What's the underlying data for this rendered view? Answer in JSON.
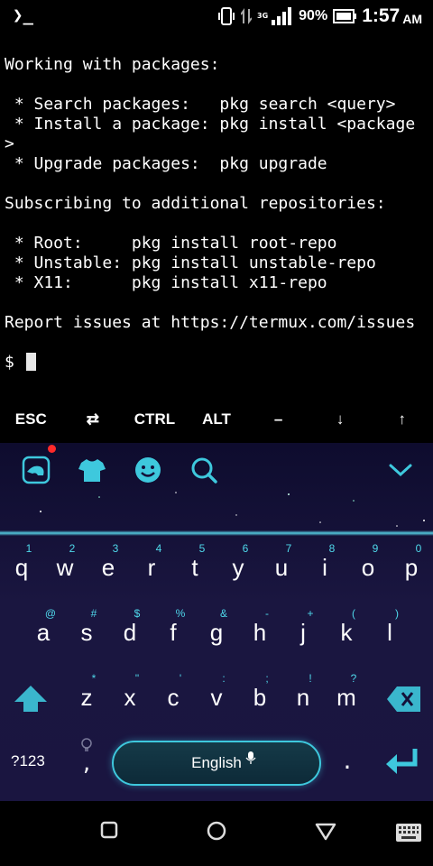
{
  "status_bar": {
    "app_icon_text": "❯_",
    "network_type": "3G",
    "battery_percent": "90%",
    "time": "1:57",
    "ampm": "AM"
  },
  "terminal": {
    "lines": [
      "Working with packages:",
      "",
      " * Search packages:   pkg search <query>",
      " * Install a package: pkg install <package",
      ">",
      " * Upgrade packages:  pkg upgrade",
      "",
      "Subscribing to additional repositories:",
      "",
      " * Root:     pkg install root-repo",
      " * Unstable: pkg install unstable-repo",
      " * X11:      pkg install x11-repo",
      "",
      "Report issues at https://termux.com/issues",
      "",
      "$ "
    ]
  },
  "extra_keys": [
    "ESC",
    "⇄",
    "CTRL",
    "ALT",
    "–",
    "↓",
    "↑"
  ],
  "keyboard": {
    "accent_color": "#4fd8ea",
    "row1": [
      {
        "hint": "1",
        "ch": "q"
      },
      {
        "hint": "2",
        "ch": "w"
      },
      {
        "hint": "3",
        "ch": "e"
      },
      {
        "hint": "4",
        "ch": "r"
      },
      {
        "hint": "5",
        "ch": "t"
      },
      {
        "hint": "6",
        "ch": "y"
      },
      {
        "hint": "7",
        "ch": "u"
      },
      {
        "hint": "8",
        "ch": "i"
      },
      {
        "hint": "9",
        "ch": "o"
      },
      {
        "hint": "0",
        "ch": "p"
      }
    ],
    "row2": [
      {
        "hint": "@",
        "ch": "a"
      },
      {
        "hint": "#",
        "ch": "s"
      },
      {
        "hint": "$",
        "ch": "d"
      },
      {
        "hint": "%",
        "ch": "f"
      },
      {
        "hint": "&",
        "ch": "g"
      },
      {
        "hint": "-",
        "ch": "h"
      },
      {
        "hint": "+",
        "ch": "j"
      },
      {
        "hint": "(",
        "ch": "k"
      },
      {
        "hint": ")",
        "ch": "l"
      }
    ],
    "row3": [
      {
        "hint": "*",
        "ch": "z"
      },
      {
        "hint": "\"",
        "ch": "x"
      },
      {
        "hint": "'",
        "ch": "c"
      },
      {
        "hint": ":",
        "ch": "v"
      },
      {
        "hint": ";",
        "ch": "b"
      },
      {
        "hint": "!",
        "ch": "n"
      },
      {
        "hint": "?",
        "ch": "m"
      }
    ],
    "symbols_label": "?123",
    "comma": ",",
    "space_label": "English",
    "period": "."
  },
  "icons": {
    "toolbar": [
      "sticker-icon",
      "theme-shirt-icon",
      "emoji-icon",
      "search-icon",
      "collapse-chevron-icon"
    ],
    "navbar": [
      "recents-square-icon",
      "home-circle-icon",
      "back-triangle-icon",
      "keyboard-switch-icon"
    ]
  }
}
